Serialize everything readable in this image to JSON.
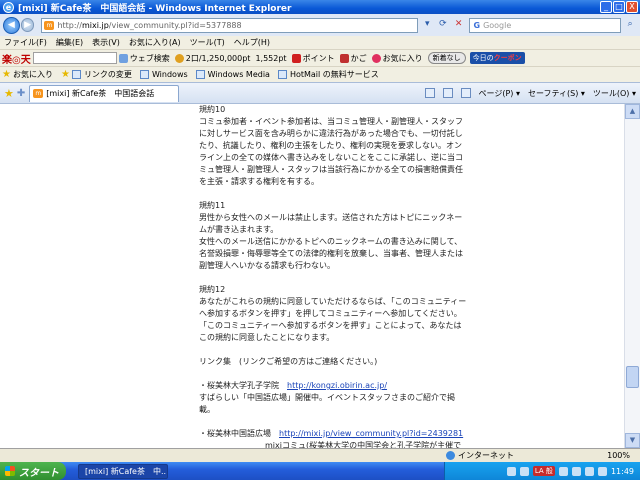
{
  "window": {
    "title": "[mixi] 新Cafe茶　中国語会話 - Windows Internet Explorer",
    "controls": [
      "_",
      "□",
      "X"
    ]
  },
  "address_bar": {
    "url_prefix": "http://",
    "url_host": "mixi.jp",
    "url_path": "/view_community.pl?id=5377888",
    "search_placeholder": "Google",
    "search_brand": "G"
  },
  "menu": [
    "ファイル(F)",
    "編集(E)",
    "表示(V)",
    "お気に入り(A)",
    "ツール(T)",
    "ヘルプ(H)"
  ],
  "rakuten_toolbar": {
    "logo": "楽◎天",
    "web_search": "ウェブ検索",
    "points": "2口/1,250,000pt",
    "pt": "1,552pt",
    "point_btn": "ポイント",
    "cart": "かご",
    "favorites": "お気に入り",
    "newest": "新着なし",
    "coupon_prefix": "今日の",
    "coupon_main": "クーポン"
  },
  "links_bar": {
    "favorites": "お気に入り",
    "items": [
      "リンクの変更",
      "Windows",
      "Windows Media",
      "HotMail の無料サービス"
    ]
  },
  "tab": {
    "label": "[mixi] 新Cafe茶　中国語会話"
  },
  "command_bar": {
    "page": "ページ(P) ▾",
    "safety": "セーフティ(S) ▾",
    "tools": "ツール(O) ▾"
  },
  "content": {
    "rule10_title": "規約10",
    "rule10_body": "コミュ参加者・イベント参加者は、当コミュ管理人・副管理人・スタッフに対しサービス面を含み明らかに違法行為があった場合でも、一切付託したり、抗議したり、権利の主張をしたり、権利の実現を要求しない。オンライン上の全ての媒体へ書き込みをしないことをここに承諾し、逆に当コミュ管理人・副管理人・スタッフは当該行為にかかる全ての損害賠償責任を主張・請求する権利を有する。",
    "rule11_title": "規約11",
    "rule11_body1": "男性から女性へのメールは禁止します。送信された方はトピにニックネームが書き込まれます。",
    "rule11_body2": "女性へのメール送信にかかるトピへのニックネームの書き込みに関して、名誉毀損罪・侮辱罪等全ての法律的権利を放棄し、当事者、管理人または副管理人へいかなる請求も行わない。",
    "rule12_title": "規約12",
    "rule12_body": "あなたがこれらの規約に同意していただけるならば、「このコミュニティーへ参加するボタンを押す」を押してコミュニティーへ参加してください。「このコミュニティーへ参加するボタンを押す」ことによって、あなたはこの規約に同意したことになります。",
    "links_heading": "リンク集　(リンクご希望の方はご連絡ください。)",
    "link1_label": "・桜美林大学孔子学院　",
    "link1_url": "http://kongzi.obirin.ac.jp/",
    "link1_note": "すばらしい「中国語広場」開催中。イベントスタッフさまのご紹介で掲載。",
    "link2_label": "・桜美林中国語広場　",
    "link2_url": "http://mixi.jp/view_community.pl?id=2439281",
    "link2_note": "mixiコミュ(桜美林大学の中国学会と孔子学院が主催です)"
  },
  "status_bar": {
    "zone": "インターネット",
    "zoom": "100%"
  },
  "taskbar": {
    "start": "スタート",
    "item": "[mixi] 新Cafe茶　中...",
    "tray_la": "LA 般",
    "clock": "11:49"
  }
}
